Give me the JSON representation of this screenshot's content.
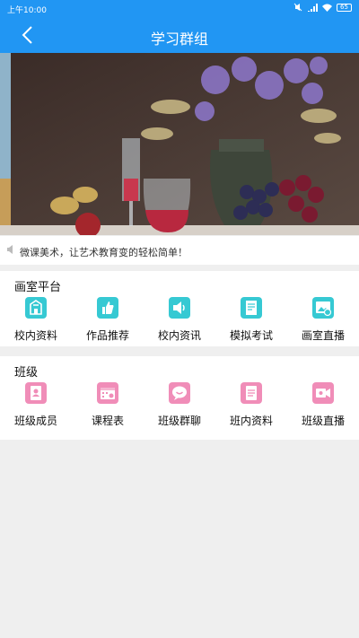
{
  "status_bar": {
    "time": "上午10:00",
    "battery": "65"
  },
  "header": {
    "title": "学习群组"
  },
  "notice": {
    "text": "微课美术，让艺术教育变的轻松简单！"
  },
  "platform": {
    "title": "画室平台",
    "accent": "#36c9d3",
    "items": [
      {
        "label": "校内资料",
        "icon": "school-icon"
      },
      {
        "label": "作品推荐",
        "icon": "thumbs-up-icon"
      },
      {
        "label": "校内资讯",
        "icon": "speaker-icon"
      },
      {
        "label": "模拟考试",
        "icon": "exam-icon"
      },
      {
        "label": "画室直播",
        "icon": "live-image-icon"
      }
    ]
  },
  "class_section": {
    "title": "班级",
    "accent": "#f08db8",
    "items": [
      {
        "label": "班级成员",
        "icon": "contacts-icon"
      },
      {
        "label": "课程表",
        "icon": "calendar-icon"
      },
      {
        "label": "班级群聊",
        "icon": "chat-icon"
      },
      {
        "label": "班内资料",
        "icon": "document-icon"
      },
      {
        "label": "班级直播",
        "icon": "video-icon"
      }
    ]
  }
}
